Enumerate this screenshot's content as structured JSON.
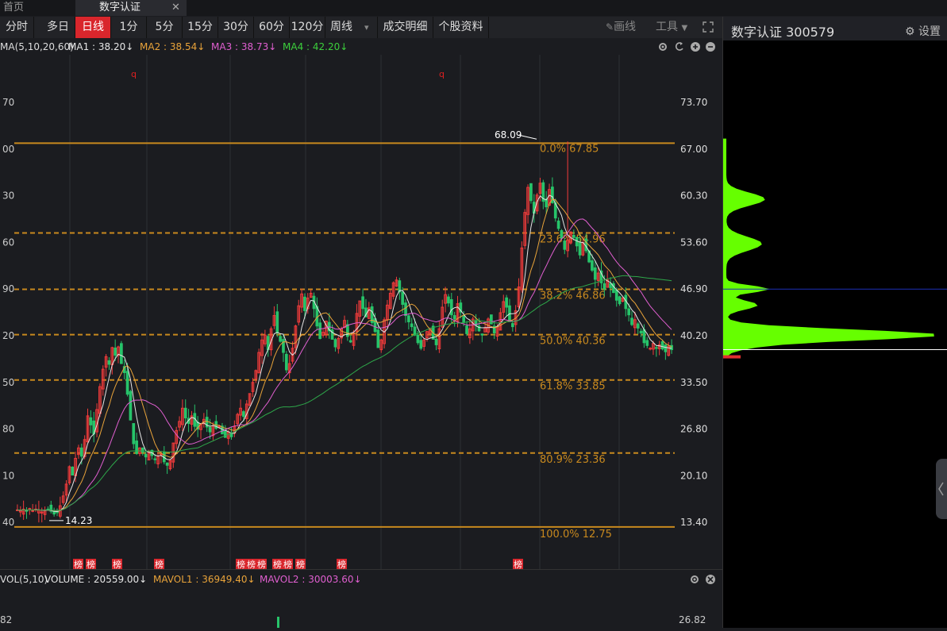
{
  "window": {
    "tabs": [
      {
        "label": "首页"
      },
      {
        "label": "数字认证"
      }
    ],
    "close_glyph": "✕"
  },
  "toolbar": {
    "periods": [
      {
        "label": "分时"
      },
      {
        "label": "多日"
      },
      {
        "label": "日线",
        "active": true
      },
      {
        "label": "1分"
      },
      {
        "label": "5分"
      },
      {
        "label": "15分"
      },
      {
        "label": "30分"
      },
      {
        "label": "60分"
      },
      {
        "label": "120分"
      },
      {
        "label": "周线"
      }
    ],
    "dropdown_glyph": "▾",
    "extra": [
      {
        "label": "成交明细"
      },
      {
        "label": "个股资料"
      }
    ],
    "draw_label": "画线",
    "tools_label": "工具",
    "fullscreen_icon": "fullscreen-icon"
  },
  "stock": {
    "title": "数字认证 300579",
    "settings_label": "设置"
  },
  "indicator": {
    "name": "MA(5,10,20,60)",
    "items": [
      {
        "text": "MA1 : 38.20↓",
        "color": "#e6e6e6"
      },
      {
        "text": "MA2 : 38.54↓",
        "color": "#e8a33a"
      },
      {
        "text": "MA3 : 38.73↓",
        "color": "#e05fd0"
      },
      {
        "text": "MA4 : 42.20↓",
        "color": "#3ccf3c"
      }
    ]
  },
  "volume": {
    "name": "VOL(5,10)",
    "items": [
      {
        "text": "VOLUME : 20559.00↓",
        "color": "#e6e6e6"
      },
      {
        "text": "MAVOL1 : 36949.40↓",
        "color": "#e8a33a"
      },
      {
        "text": "MAVOL2 : 30003.60↓",
        "color": "#e05fd0"
      }
    ],
    "axis_label": "26.82",
    "left_label": "82"
  },
  "colors": {
    "up": "#f23b3b",
    "down": "#27c46a",
    "fib": "#c8891e",
    "grid": "#2d2f35",
    "profile": "#66ff00",
    "ma60": "#2ea84a"
  },
  "chart_data": {
    "type": "candlestick",
    "y_axis_right": [
      "73.70",
      "67.00",
      "60.30",
      "53.60",
      "46.90",
      "40.20",
      "33.50",
      "26.80",
      "20.10",
      "13.40"
    ],
    "y_axis_left": [
      "70",
      "00",
      "30",
      "60",
      "90",
      "20",
      "50",
      "80",
      "10",
      "40"
    ],
    "ylim": [
      11.5,
      77.7
    ],
    "fibonacci": [
      {
        "pct": "0.0%",
        "value": 67.85
      },
      {
        "pct": "23.6%",
        "value": 54.96
      },
      {
        "pct": "38.2%",
        "value": 46.86
      },
      {
        "pct": "50.0%",
        "value": 40.36
      },
      {
        "pct": "61.8%",
        "value": 33.85
      },
      {
        "pct": "80.9%",
        "value": 23.36
      },
      {
        "pct": "100.0%",
        "value": 12.75
      }
    ],
    "high_label": "68.09",
    "low_label": "14.23",
    "closes": [
      15.2,
      15.1,
      15.3,
      15.0,
      15.4,
      15.1,
      15.3,
      15.2,
      14.9,
      15.1,
      15.3,
      15.0,
      14.6,
      14.8,
      15.8,
      17.2,
      18.9,
      21.4,
      20.2,
      22.6,
      24.1,
      22.9,
      25.3,
      28.7,
      27.4,
      26.1,
      29.6,
      32.9,
      35.4,
      37.2,
      36.1,
      38.5,
      37.4,
      38.6,
      36.2,
      34.9,
      31.8,
      28.1,
      24.7,
      23.3,
      24.1,
      23.5,
      22.8,
      23.6,
      23.0,
      22.4,
      22.9,
      23.2,
      22.1,
      21.6,
      22.3,
      24.8,
      26.6,
      27.9,
      29.8,
      28.4,
      27.6,
      28.7,
      27.2,
      26.8,
      27.5,
      28.2,
      27.1,
      26.4,
      27.3,
      26.9,
      27.2,
      26.1,
      25.6,
      26.4,
      25.7,
      27.2,
      28.9,
      29.8,
      28.6,
      30.4,
      31.9,
      33.5,
      35.2,
      37.8,
      39.6,
      40.3,
      38.2,
      41.2,
      43.1,
      40.6,
      39.4,
      37.8,
      35.3,
      36.2,
      38.4,
      41.6,
      44.5,
      46.2,
      43.8,
      45.6,
      46.3,
      44.1,
      41.6,
      39.8,
      40.7,
      42.3,
      40.9,
      39.7,
      38.6,
      39.8,
      41.2,
      42.4,
      40.1,
      39.3,
      40.6,
      43.4,
      45.2,
      44.1,
      42.9,
      44.2,
      42.1,
      40.8,
      38.5,
      39.6,
      42.5,
      44.6,
      46.3,
      47.8,
      48.2,
      46.5,
      44.7,
      43.1,
      42.2,
      41.5,
      40.3,
      39.2,
      38.4,
      39.6,
      40.8,
      41.3,
      39.7,
      38.9,
      41.2,
      44.3,
      46.1,
      44.9,
      43.2,
      42.6,
      44.8,
      43.6,
      42.1,
      40.5,
      41.2,
      42.6,
      41.7,
      40.9,
      40.3,
      41.3,
      42.6,
      41.9,
      40.6,
      41.5,
      43.5,
      45.1,
      44.3,
      42.4,
      41.5,
      43.8,
      47.2,
      52.8,
      57.9,
      61.5,
      59.6,
      57.8,
      60.4,
      62.1,
      59.5,
      58.7,
      61.2,
      59.3,
      57.1,
      55.6,
      54.2,
      52.6,
      53.9,
      55.1,
      54.3,
      53.1,
      51.8,
      53.6,
      52.4,
      50.8,
      49.6,
      48.3,
      49.2,
      47.8,
      46.9,
      48.2,
      47.1,
      46.4,
      45.3,
      44.8,
      45.6,
      44.1,
      43.2,
      41.8,
      42.5,
      41.3,
      40.6,
      39.2,
      38.8,
      38.4,
      39.1,
      38.5,
      38.9,
      38.3,
      37.9,
      38.7,
      38.2
    ],
    "badge_label": "榜",
    "q_marker": "q"
  }
}
